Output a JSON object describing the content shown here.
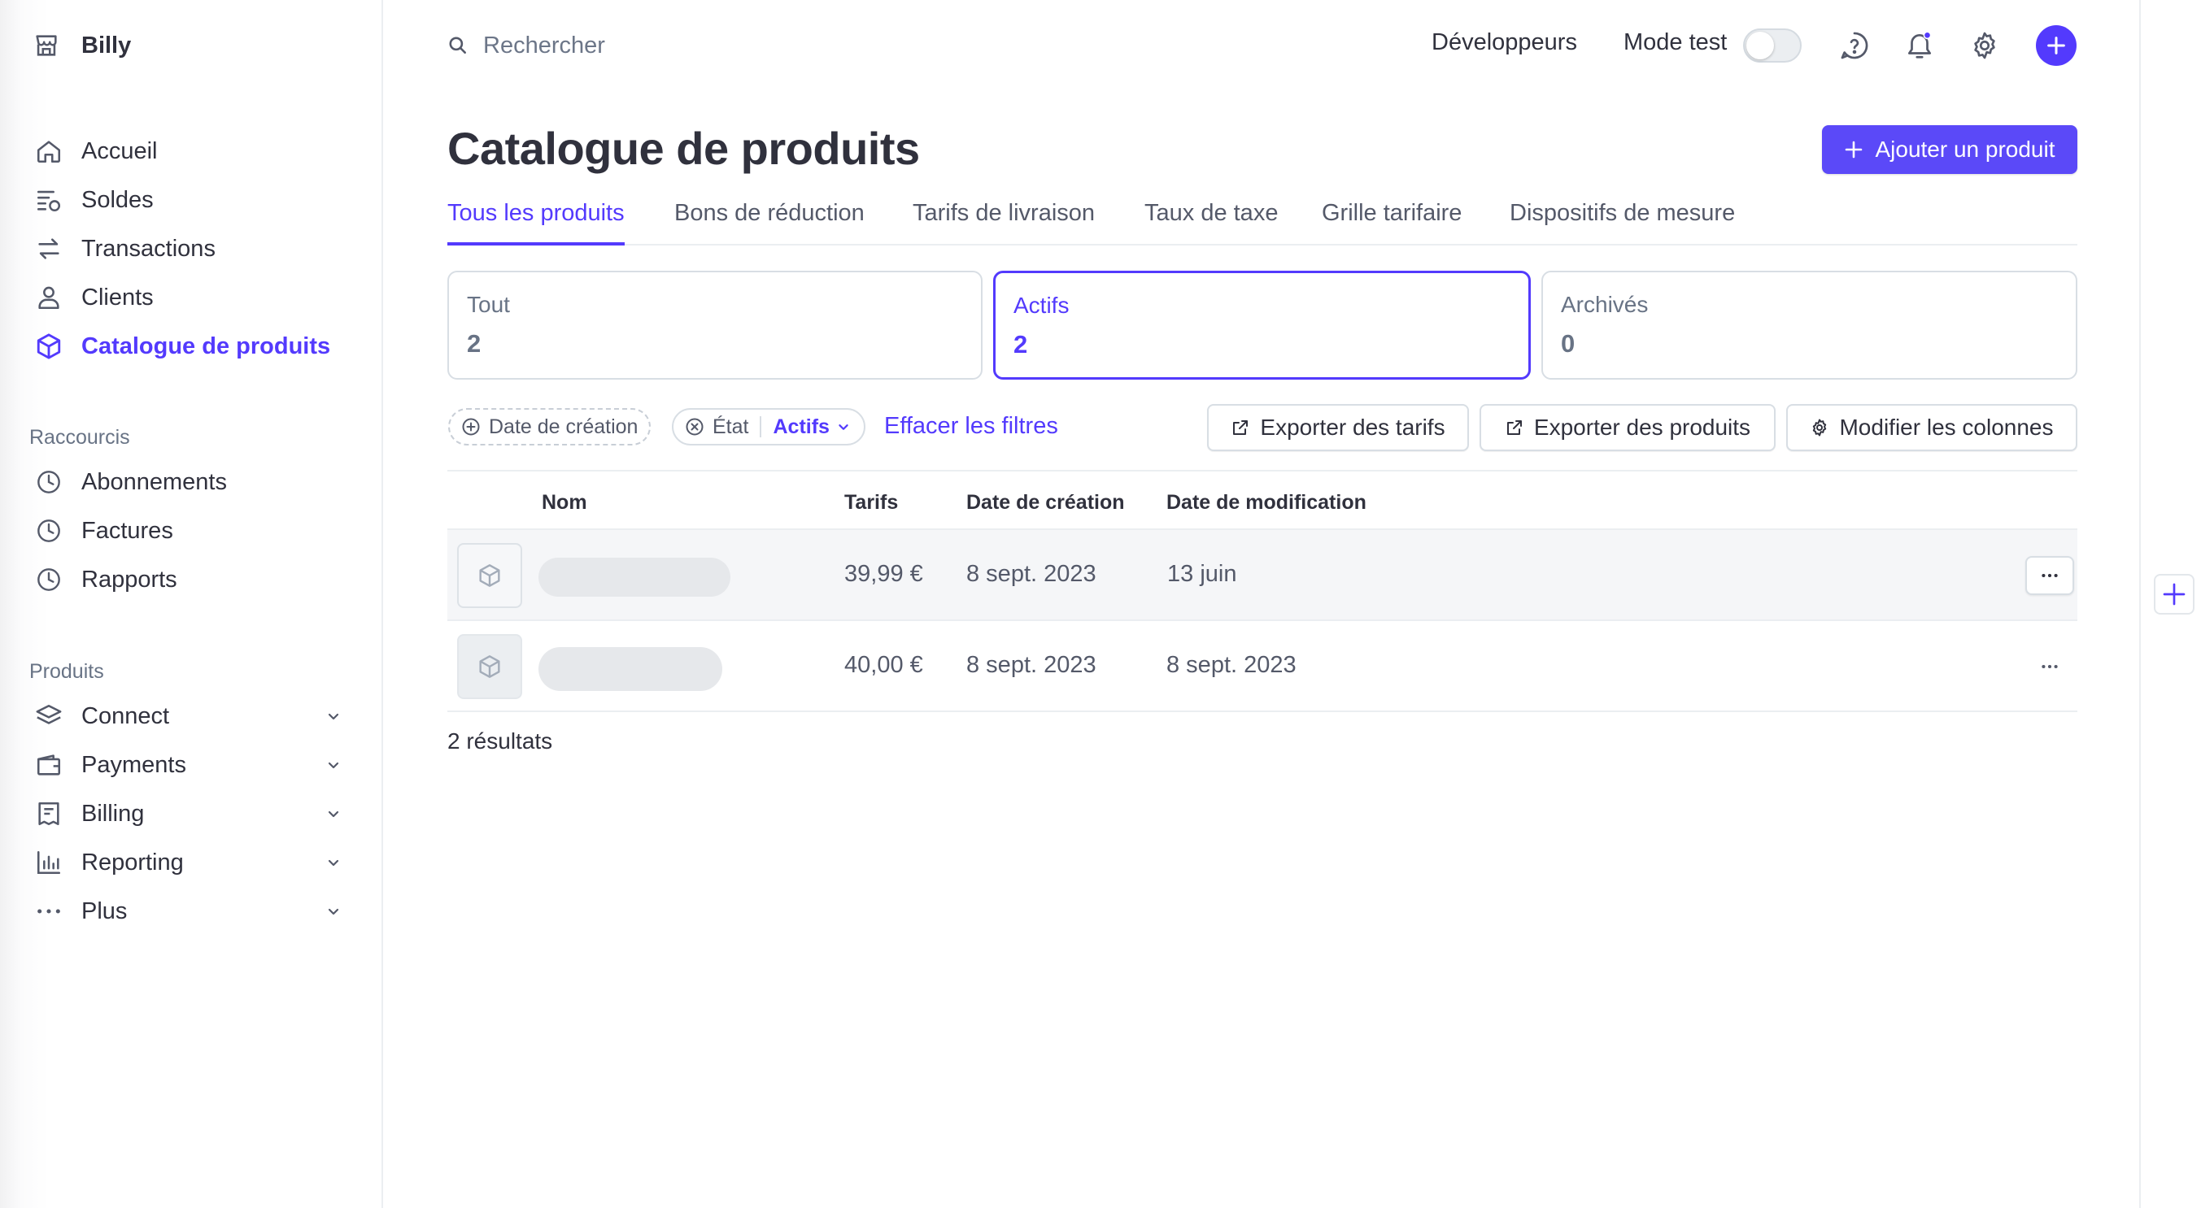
{
  "account": {
    "name": "Billy",
    "icon": "store-icon"
  },
  "sidebar": {
    "main_items": [
      {
        "label": "Accueil",
        "icon": "home-icon"
      },
      {
        "label": "Soldes",
        "icon": "balance-icon"
      },
      {
        "label": "Transactions",
        "icon": "arrows-icon"
      },
      {
        "label": "Clients",
        "icon": "person-icon"
      },
      {
        "label": "Catalogue de produits",
        "icon": "box-icon",
        "active": true
      }
    ],
    "shortcuts_label": "Raccourcis",
    "shortcuts": [
      {
        "label": "Abonnements",
        "icon": "clock-icon"
      },
      {
        "label": "Factures",
        "icon": "clock-icon"
      },
      {
        "label": "Rapports",
        "icon": "clock-icon"
      }
    ],
    "products_label": "Produits",
    "products": [
      {
        "label": "Connect",
        "icon": "layers-icon"
      },
      {
        "label": "Payments",
        "icon": "wallet-icon"
      },
      {
        "label": "Billing",
        "icon": "invoice-icon"
      },
      {
        "label": "Reporting",
        "icon": "bar-chart-icon"
      },
      {
        "label": "Plus",
        "icon": "dots-icon"
      }
    ]
  },
  "topbar": {
    "search_placeholder": "Rechercher",
    "developers": "Développeurs",
    "test_mode": "Mode test",
    "test_mode_on": false
  },
  "header": {
    "title": "Catalogue de produits",
    "add_button": "Ajouter un produit"
  },
  "tabs": [
    "Tous les produits",
    "Bons de réduction",
    "Tarifs de livraison",
    "Taux de taxe",
    "Grille tarifaire",
    "Dispositifs de mesure"
  ],
  "filter_cards": [
    {
      "label": "Tout",
      "count": "2"
    },
    {
      "label": "Actifs",
      "count": "2",
      "selected": true
    },
    {
      "label": "Archivés",
      "count": "0"
    }
  ],
  "filters": {
    "created": "Date de création",
    "status_label": "État",
    "status_value": "Actifs",
    "clear": "Effacer les filtres"
  },
  "actions": {
    "export_prices": "Exporter des tarifs",
    "export_products": "Exporter des produits",
    "edit_columns": "Modifier les colonnes"
  },
  "table": {
    "columns": [
      "Nom",
      "Tarifs",
      "Date de création",
      "Date de modification"
    ],
    "rows": [
      {
        "price": "39,99 €",
        "created": "8 sept. 2023",
        "updated": "13 juin"
      },
      {
        "price": "40,00 €",
        "created": "8 sept. 2023",
        "updated": "8 sept. 2023"
      }
    ],
    "results": "2 résultats"
  },
  "colors": {
    "accent": "#533afd",
    "text": "#30313d",
    "muted": "#687385",
    "border": "#d8dee4"
  }
}
